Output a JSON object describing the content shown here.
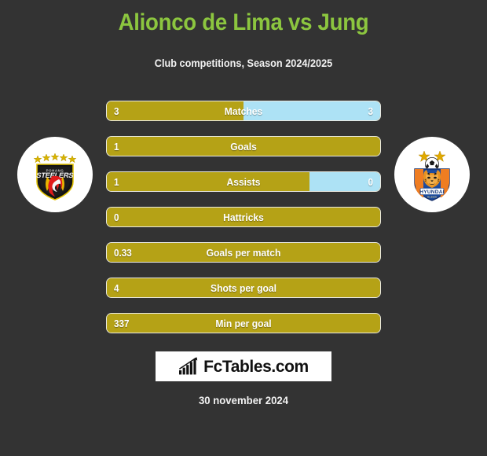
{
  "header": {
    "title": "Alionco de Lima vs Jung",
    "subtitle": "Club competitions, Season 2024/2025",
    "title_color": "#8cc63f",
    "subtitle_color": "#f2f2f2"
  },
  "theme": {
    "background": "#333333",
    "home_bar_color": "#b5a216",
    "away_bar_color": "#ade2f5",
    "bar_border_color": "#e9e9e0",
    "value_text_color": "#ffffff"
  },
  "teams": {
    "home": {
      "logo_name": "pohang-steelers-crest-icon",
      "crest_text": "STEELERS",
      "star_count": 5
    },
    "away": {
      "logo_name": "ulsan-hyundai-crest-icon",
      "crest_text": "HYUNDAI",
      "star_count": 2
    }
  },
  "chart_data": {
    "type": "bar",
    "title": "Alionco de Lima vs Jung",
    "subtitle": "Club competitions, Season 2024/2025",
    "orientation": "horizontal-diverging",
    "categories": [
      "Matches",
      "Goals",
      "Assists",
      "Hattricks",
      "Goals per match",
      "Shots per goal",
      "Min per goal"
    ],
    "series": [
      {
        "name": "Alionco de Lima",
        "color": "#b5a216",
        "values": [
          3,
          1,
          1,
          0,
          0.33,
          4,
          337
        ]
      },
      {
        "name": "Jung",
        "color": "#ade2f5",
        "values": [
          3,
          null,
          0,
          null,
          null,
          null,
          null
        ]
      }
    ],
    "legend_position": "none",
    "grid": false
  },
  "stats": [
    {
      "label": "Matches",
      "home_value": "3",
      "away_value": "3",
      "home_pct": 50,
      "away_pct": 50,
      "show_away": true
    },
    {
      "label": "Goals",
      "home_value": "1",
      "away_value": "",
      "home_pct": 100,
      "away_pct": 0,
      "show_away": false
    },
    {
      "label": "Assists",
      "home_value": "1",
      "away_value": "0",
      "home_pct": 74,
      "away_pct": 26,
      "show_away": true
    },
    {
      "label": "Hattricks",
      "home_value": "0",
      "away_value": "",
      "home_pct": 100,
      "away_pct": 0,
      "show_away": false
    },
    {
      "label": "Goals per match",
      "home_value": "0.33",
      "away_value": "",
      "home_pct": 100,
      "away_pct": 0,
      "show_away": false
    },
    {
      "label": "Shots per goal",
      "home_value": "4",
      "away_value": "",
      "home_pct": 100,
      "away_pct": 0,
      "show_away": false
    },
    {
      "label": "Min per goal",
      "home_value": "337",
      "away_value": "",
      "home_pct": 100,
      "away_pct": 0,
      "show_away": false
    }
  ],
  "footer": {
    "brand_name": "FcTables.com",
    "brand_icon_name": "bar-chart-growth-icon",
    "date": "30 november 2024"
  }
}
